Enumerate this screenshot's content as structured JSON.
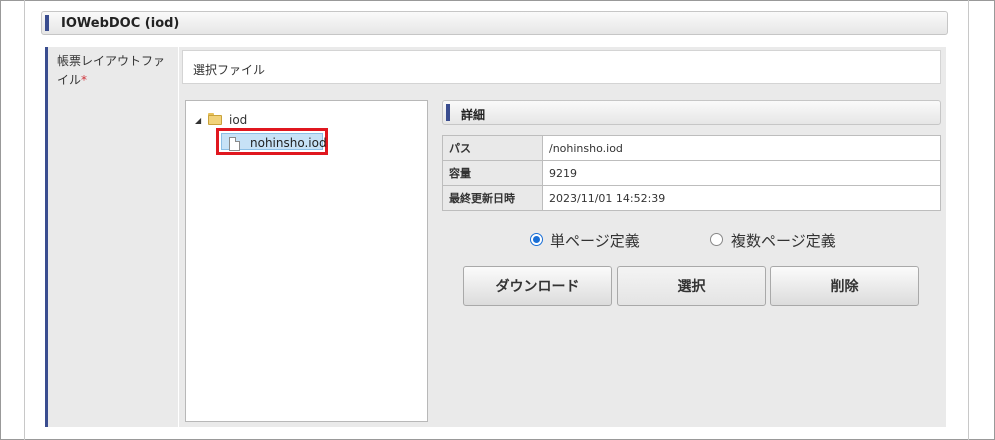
{
  "header": {
    "title": "IOWebDOC (iod)"
  },
  "form": {
    "field_label": "帳票レイアウトファイル",
    "required_mark": "*",
    "section_title": "選択ファイル"
  },
  "tree": {
    "folder": {
      "name": "iod",
      "expanded": true
    },
    "files": [
      {
        "name": "nohinsho.iod",
        "selected": true
      }
    ]
  },
  "detail": {
    "title": "詳細",
    "rows": [
      {
        "key": "パス",
        "value": "/nohinsho.iod"
      },
      {
        "key": "容量",
        "value": "9219"
      },
      {
        "key": "最終更新日時",
        "value": "2023/11/01 14:52:39"
      }
    ]
  },
  "options": {
    "single": {
      "label": "単ページ定義",
      "checked": true
    },
    "multi": {
      "label": "複数ページ定義",
      "checked": false
    }
  },
  "buttons": {
    "download": "ダウンロード",
    "select": "選択",
    "delete": "削除"
  },
  "colors": {
    "accent": "#3a4d8f",
    "highlight_border": "#e0171f",
    "required": "#d0333a",
    "radio": "#1a6fd6"
  }
}
